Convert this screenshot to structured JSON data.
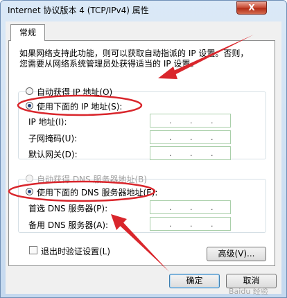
{
  "window": {
    "title": "Internet 协议版本 4 (TCP/IPv4) 属性",
    "close_glyph": "X"
  },
  "tab": {
    "label": "常规"
  },
  "description": {
    "line1": "如果网络支持此功能，则可以获取自动指派的 IP 设置。否则，",
    "line2": "您需要从网络系统管理员处获得适当的 IP 设置。"
  },
  "ip_section": {
    "auto_label": "自动获得 IP 地址(O)",
    "manual_label": "使用下面的 IP 地址(S):",
    "manual_selected": true,
    "fields": [
      {
        "label": "IP 地址(I):"
      },
      {
        "label": "子网掩码(U):"
      },
      {
        "label": "默认网关(D):"
      }
    ]
  },
  "dns_section": {
    "auto_label": "自动获得 DNS 服务器地址(B)",
    "manual_label": "使用下面的 DNS 服务器地址(E):",
    "manual_selected": true,
    "fields": [
      {
        "label": "首选 DNS 服务器(P):"
      },
      {
        "label": "备用 DNS 服务器(A):"
      }
    ]
  },
  "validate": {
    "label": "退出时验证设置(L)",
    "checked": false
  },
  "advanced_button": {
    "label": "高级(V)..."
  },
  "ok_button": {
    "label": "确定"
  },
  "cancel_button": {
    "label": "取消"
  },
  "ip_separator": ".",
  "watermark": {
    "text": "Baidu 经验"
  },
  "annotation_color": "#d9262c"
}
